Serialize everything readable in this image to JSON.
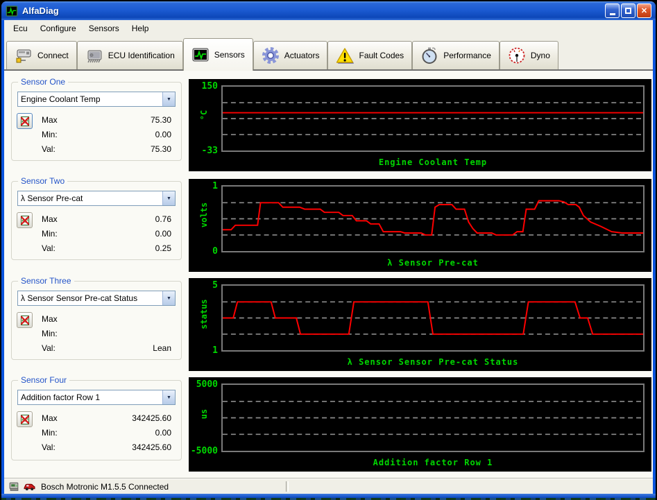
{
  "window": {
    "title": "AlfaDiag"
  },
  "menu": {
    "items": [
      "Ecu",
      "Configure",
      "Sensors",
      "Help"
    ]
  },
  "toolbar": {
    "tabs": [
      {
        "label": "Connect",
        "icon": "connector-icon",
        "active": false
      },
      {
        "label": "ECU Identification",
        "icon": "chip-icon",
        "active": false
      },
      {
        "label": "Sensors",
        "icon": "scope-icon",
        "active": true
      },
      {
        "label": "Actuators",
        "icon": "gear-icon",
        "active": false
      },
      {
        "label": "Fault Codes",
        "icon": "warning-icon",
        "active": false
      },
      {
        "label": "Performance",
        "icon": "stopwatch-icon",
        "active": false
      },
      {
        "label": "Dyno",
        "icon": "gauge-icon",
        "active": false
      }
    ]
  },
  "sensors": [
    {
      "group_label": "Sensor One",
      "selected": "Engine Coolant Temp",
      "rows": [
        {
          "label": "Max",
          "value": "75.30"
        },
        {
          "label": "Min:",
          "value": "0.00"
        },
        {
          "label": "Val:",
          "value": "75.30"
        }
      ]
    },
    {
      "group_label": "Sensor Two",
      "selected": "λ Sensor Pre-cat",
      "rows": [
        {
          "label": "Max",
          "value": "0.76"
        },
        {
          "label": "Min:",
          "value": "0.00"
        },
        {
          "label": "Val:",
          "value": "0.25"
        }
      ]
    },
    {
      "group_label": "Sensor Three",
      "selected": "λ Sensor Sensor Pre-cat Status",
      "rows": [
        {
          "label": "Max",
          "value": ""
        },
        {
          "label": "Min:",
          "value": ""
        },
        {
          "label": "Val:",
          "value": "Lean"
        }
      ]
    },
    {
      "group_label": "Sensor Four",
      "selected": "Addition factor Row 1",
      "rows": [
        {
          "label": "Max",
          "value": "342425.60"
        },
        {
          "label": "Min:",
          "value": "0.00"
        },
        {
          "label": "Val:",
          "value": "342425.60"
        }
      ]
    }
  ],
  "chart_data": [
    {
      "type": "line",
      "title": "Engine Coolant Temp",
      "unit": "°C",
      "y_top_label": "150",
      "y_bottom_label": "-33",
      "ymin": -33,
      "ymax": 150,
      "grid": "on",
      "gridline_fracs": [
        0.25,
        0.5,
        0.75
      ],
      "trace": [
        [
          0,
          75.3
        ],
        [
          1,
          75.3
        ]
      ]
    },
    {
      "type": "line",
      "title": "λ Sensor Pre-cat",
      "unit": "volts",
      "y_top_label": "1",
      "y_bottom_label": "0",
      "ymin": 0,
      "ymax": 1,
      "grid": "on",
      "gridline_fracs": [
        0.25,
        0.5,
        0.75
      ],
      "trace": [
        [
          0,
          0.33
        ],
        [
          0.02,
          0.33
        ],
        [
          0.03,
          0.4
        ],
        [
          0.083,
          0.4
        ],
        [
          0.09,
          0.75
        ],
        [
          0.133,
          0.75
        ],
        [
          0.143,
          0.68
        ],
        [
          0.183,
          0.68
        ],
        [
          0.195,
          0.65
        ],
        [
          0.232,
          0.65
        ],
        [
          0.242,
          0.6
        ],
        [
          0.276,
          0.6
        ],
        [
          0.286,
          0.55
        ],
        [
          0.308,
          0.55
        ],
        [
          0.318,
          0.47
        ],
        [
          0.342,
          0.47
        ],
        [
          0.352,
          0.42
        ],
        [
          0.372,
          0.42
        ],
        [
          0.382,
          0.3
        ],
        [
          0.423,
          0.3
        ],
        [
          0.433,
          0.28
        ],
        [
          0.472,
          0.28
        ],
        [
          0.482,
          0.25
        ],
        [
          0.497,
          0.25
        ],
        [
          0.505,
          0.68
        ],
        [
          0.515,
          0.72
        ],
        [
          0.545,
          0.72
        ],
        [
          0.555,
          0.65
        ],
        [
          0.575,
          0.65
        ],
        [
          0.585,
          0.45
        ],
        [
          0.595,
          0.35
        ],
        [
          0.605,
          0.28
        ],
        [
          0.64,
          0.28
        ],
        [
          0.65,
          0.25
        ],
        [
          0.69,
          0.25
        ],
        [
          0.7,
          0.3
        ],
        [
          0.714,
          0.3
        ],
        [
          0.722,
          0.65
        ],
        [
          0.742,
          0.65
        ],
        [
          0.752,
          0.78
        ],
        [
          0.8,
          0.78
        ],
        [
          0.812,
          0.76
        ],
        [
          0.822,
          0.72
        ],
        [
          0.84,
          0.72
        ],
        [
          0.848,
          0.68
        ],
        [
          0.858,
          0.55
        ],
        [
          0.875,
          0.45
        ],
        [
          0.9,
          0.38
        ],
        [
          0.925,
          0.3
        ],
        [
          0.95,
          0.28
        ],
        [
          1,
          0.28
        ]
      ]
    },
    {
      "type": "line",
      "title": "λ Sensor Sensor Pre-cat Status",
      "unit": "status",
      "y_top_label": "5",
      "y_bottom_label": "1",
      "ymin": 1,
      "ymax": 5,
      "grid": "on",
      "gridline_fracs": [
        0.25,
        0.5,
        0.75
      ],
      "trace": [
        [
          0,
          3
        ],
        [
          0.025,
          3
        ],
        [
          0.035,
          4
        ],
        [
          0.115,
          4
        ],
        [
          0.125,
          3
        ],
        [
          0.175,
          3
        ],
        [
          0.185,
          2
        ],
        [
          0.3,
          2
        ],
        [
          0.312,
          4
        ],
        [
          0.488,
          4
        ],
        [
          0.5,
          2
        ],
        [
          0.715,
          2
        ],
        [
          0.727,
          4
        ],
        [
          0.838,
          4
        ],
        [
          0.85,
          3
        ],
        [
          0.868,
          3
        ],
        [
          0.88,
          2
        ],
        [
          1,
          2
        ]
      ]
    },
    {
      "type": "line",
      "title": "Addition factor Row 1",
      "unit": "us",
      "y_top_label": "5000",
      "y_bottom_label": "-5000",
      "ymin": -5000,
      "ymax": 5000,
      "grid": "on",
      "gridline_fracs": [
        0.25,
        0.5,
        0.75
      ],
      "trace": []
    }
  ],
  "statusbar": {
    "text": "Bosch Motronic M1.5.5 Connected"
  },
  "colors": {
    "chart_text": "#00D800",
    "trace": "#FF0000",
    "grid": "#8C8C8C",
    "titlebar_blue": "#1C5BD2",
    "window_border_blue": "#0A53DD",
    "group_label_blue": "#2353C8"
  }
}
